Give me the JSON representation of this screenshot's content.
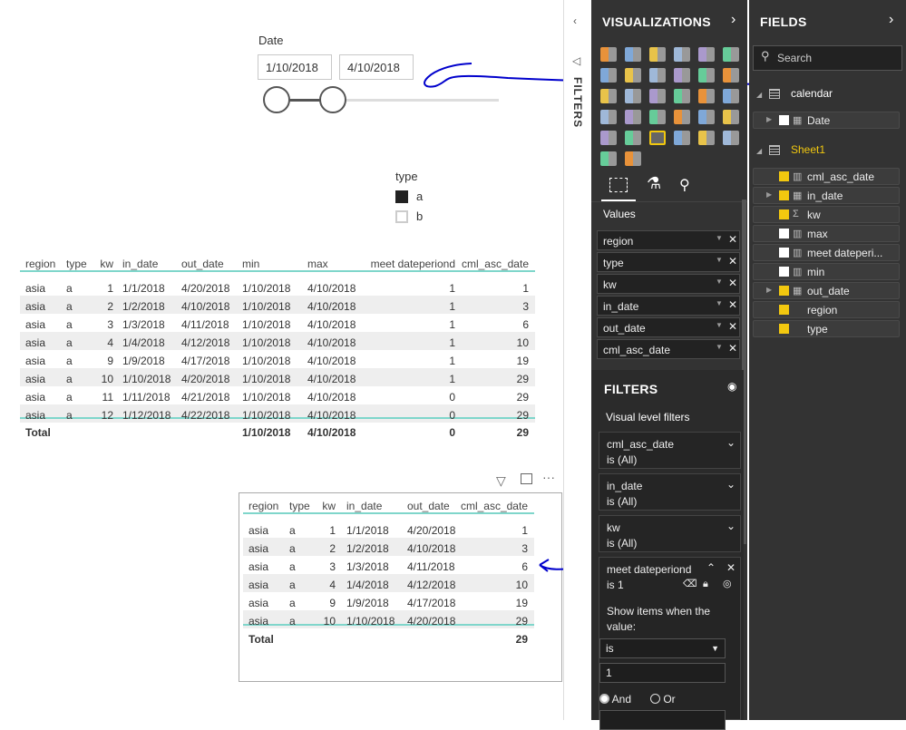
{
  "slicer": {
    "title": "Date",
    "start": "1/10/2018",
    "end": "4/10/2018"
  },
  "legend": {
    "title": "type",
    "items": [
      {
        "label": "a",
        "filled": true
      },
      {
        "label": "b",
        "filled": false
      }
    ]
  },
  "table1": {
    "columns": [
      "region",
      "type",
      "kw",
      "in_date",
      "out_date",
      "min",
      "max",
      "meet dateperiond",
      "cml_asc_date"
    ],
    "rows": [
      [
        "asia",
        "a",
        "1",
        "1/1/2018",
        "4/20/2018",
        "1/10/2018",
        "4/10/2018",
        "1",
        "1"
      ],
      [
        "asia",
        "a",
        "2",
        "1/2/2018",
        "4/10/2018",
        "1/10/2018",
        "4/10/2018",
        "1",
        "3"
      ],
      [
        "asia",
        "a",
        "3",
        "1/3/2018",
        "4/11/2018",
        "1/10/2018",
        "4/10/2018",
        "1",
        "6"
      ],
      [
        "asia",
        "a",
        "4",
        "1/4/2018",
        "4/12/2018",
        "1/10/2018",
        "4/10/2018",
        "1",
        "10"
      ],
      [
        "asia",
        "a",
        "9",
        "1/9/2018",
        "4/17/2018",
        "1/10/2018",
        "4/10/2018",
        "1",
        "19"
      ],
      [
        "asia",
        "a",
        "10",
        "1/10/2018",
        "4/20/2018",
        "1/10/2018",
        "4/10/2018",
        "1",
        "29"
      ],
      [
        "asia",
        "a",
        "11",
        "1/11/2018",
        "4/21/2018",
        "1/10/2018",
        "4/10/2018",
        "0",
        "29"
      ],
      [
        "asia",
        "a",
        "12",
        "1/12/2018",
        "4/22/2018",
        "1/10/2018",
        "4/10/2018",
        "0",
        "29"
      ]
    ],
    "total": [
      "Total",
      "",
      "",
      "",
      "",
      "1/10/2018",
      "4/10/2018",
      "0",
      "29"
    ]
  },
  "table2": {
    "columns": [
      "region",
      "type",
      "kw",
      "in_date",
      "out_date",
      "cml_asc_date"
    ],
    "rows": [
      [
        "asia",
        "a",
        "1",
        "1/1/2018",
        "4/20/2018",
        "1"
      ],
      [
        "asia",
        "a",
        "2",
        "1/2/2018",
        "4/10/2018",
        "3"
      ],
      [
        "asia",
        "a",
        "3",
        "1/3/2018",
        "4/11/2018",
        "6"
      ],
      [
        "asia",
        "a",
        "4",
        "1/4/2018",
        "4/12/2018",
        "10"
      ],
      [
        "asia",
        "a",
        "9",
        "1/9/2018",
        "4/17/2018",
        "19"
      ],
      [
        "asia",
        "a",
        "10",
        "1/10/2018",
        "4/20/2018",
        "29"
      ]
    ],
    "total": [
      "Total",
      "",
      "",
      "",
      "",
      "29"
    ]
  },
  "filters_strip": {
    "label": "FILTERS"
  },
  "visualizations": {
    "title": "VISUALIZATIONS",
    "values_label": "Values",
    "wells": [
      "region",
      "type",
      "kw",
      "in_date",
      "out_date",
      "cml_asc_date"
    ],
    "filters_title": "FILTERS",
    "visual_level": "Visual level filters",
    "filter_cards": [
      {
        "name": "cml_asc_date",
        "state": "is (All)"
      },
      {
        "name": "in_date",
        "state": "is (All)"
      },
      {
        "name": "kw",
        "state": "is (All)"
      }
    ],
    "expanded": {
      "name": "meet dateperiond",
      "state": "is 1",
      "show_items": "Show items when the value:",
      "operator": "is",
      "value": "1",
      "and": "And",
      "or": "Or"
    }
  },
  "fields": {
    "title": "FIELDS",
    "search_placeholder": "Search",
    "tables": [
      {
        "name": "calendar",
        "items": [
          {
            "label": "Date",
            "checked": false,
            "icon": "calendar",
            "expandable": true
          }
        ]
      },
      {
        "name": "Sheet1",
        "items": [
          {
            "label": "cml_asc_date",
            "checked": true,
            "icon": "calculator"
          },
          {
            "label": "in_date",
            "checked": true,
            "icon": "calendar",
            "expandable": true
          },
          {
            "label": "kw",
            "checked": true,
            "icon": "sigma"
          },
          {
            "label": "max",
            "checked": false,
            "icon": "calculator"
          },
          {
            "label": "meet dateperi...",
            "checked": false,
            "icon": "calculator"
          },
          {
            "label": "min",
            "checked": false,
            "icon": "calculator"
          },
          {
            "label": "out_date",
            "checked": true,
            "icon": "calendar",
            "expandable": true
          },
          {
            "label": "region",
            "checked": true,
            "icon": ""
          },
          {
            "label": "type",
            "checked": true,
            "icon": ""
          }
        ]
      }
    ]
  },
  "colors": {
    "accent": "#f2c80f",
    "table_rule": "#7fd6cb",
    "panel": "#333333",
    "annotation": "#0000cc"
  }
}
